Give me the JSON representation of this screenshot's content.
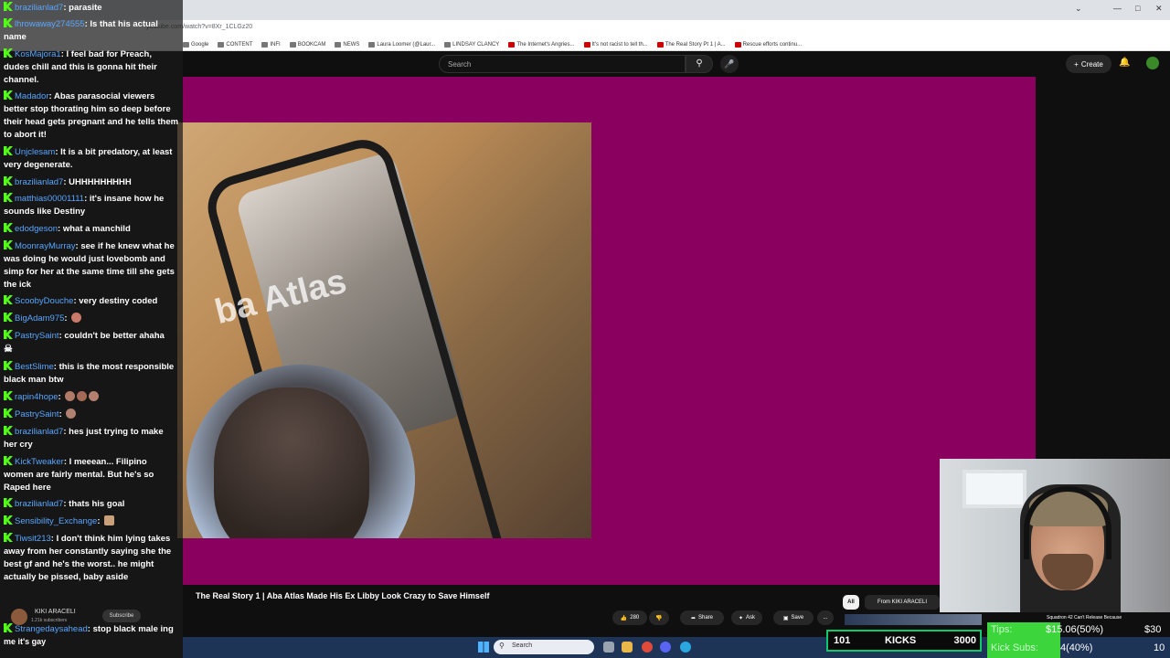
{
  "browser": {
    "url": "youtube.com/watch?v=8Xr_1CLGz20",
    "bookmarks": [
      "Google",
      "CONTENT",
      "INFI",
      "BOOKCAM",
      "NEWS",
      "Laura Loomer (@Laur...",
      "LINDSAY CLANCY",
      "The Internet's Angries...",
      "It's not racist to tell th...",
      "The Real Story Pt 1 | A...",
      "Rescue efforts continu..."
    ]
  },
  "youtube": {
    "search_placeholder": "Search",
    "create_label": "Create",
    "video_overlay_text": "ba Atlas",
    "video_title": "The Real Story 1 | Aba Atlas Made His Ex Libby Look Crazy to Save Himself",
    "channel_name": "KIKI ARACELI",
    "channel_subs": "1.21k subscribers",
    "subscribe_label": "Subscribe",
    "like_count": "280",
    "share_label": "Share",
    "ask_label": "Ask",
    "save_label": "Save",
    "more_label": "...",
    "chip_all": "All",
    "chip_from": "From KIKI ARACELI",
    "rec_title": "Squadron 42 Can't Release Because"
  },
  "chat": {
    "messages": [
      {
        "user": "brazilianlad7",
        "text": "parasite"
      },
      {
        "user": "lhrowaway274555",
        "text": "Is that his actual name"
      },
      {
        "user": "KosMajora1",
        "text": "I feel bad for Preach, dudes chill and this is gonna hit their channel."
      },
      {
        "user": "Madador",
        "text": "Abas parasocial viewers better stop thorating him so deep before their head gets pregnant and he tells them to abort it!"
      },
      {
        "user": "Unjclesam",
        "text": "It is a bit predatory, at least very degenerate."
      },
      {
        "user": "brazilianlad7",
        "text": "UHHHHHHHHH"
      },
      {
        "user": "matthias00001111",
        "text": "it's insane how he sounds like Destiny"
      },
      {
        "user": "edodgeson",
        "text": "what a manchild"
      },
      {
        "user": "MoonrayMurray",
        "text": "see if he knew what he was doing he would just lovebomb and simp for her at the same time till she gets the ick"
      },
      {
        "user": "ScoobyDouche",
        "text": "very destiny coded"
      },
      {
        "user": "BigAdam975",
        "text": ""
      },
      {
        "user": "PastrySaint",
        "text": "couldn't be better ahaha"
      },
      {
        "user": "BestSlime",
        "text": "this is the most responsible black man btw"
      },
      {
        "user": "rapin4hope",
        "text": ""
      },
      {
        "user": "PastrySaint",
        "text": ""
      },
      {
        "user": "brazilianlad7",
        "text": "hes just trying to make her cry"
      },
      {
        "user": "KickTweaker",
        "text": "I meeean... Filipino women are fairly mental. But he's so Raped here"
      },
      {
        "user": "brazilianlad7",
        "text": "thats his goal"
      },
      {
        "user": "Sensibility_Exchange",
        "text": ""
      },
      {
        "user": "Tiwsit213",
        "text": "I don't think him lying takes away from her constantly saying she the best gf and he's the worst.. he might actually be pissed, baby aside"
      },
      {
        "user": "Strangedaysahead",
        "text": "stop black male ing"
      }
    ],
    "bottom_text": "me it's gay"
  },
  "stream_overlay": {
    "kicks_left": "101",
    "kicks_label": "KICKS",
    "kicks_goal": "3000",
    "tips_label": "Tips:",
    "tips_value": "$15.06(50%)",
    "tips_goal": "$30",
    "subs_label": "Kick Subs:",
    "subs_value": "4(40%)",
    "subs_goal": "10"
  },
  "taskbar": {
    "search_label": "Search"
  },
  "colors": {
    "player_bg": "#8a005e",
    "kick_green": "#53fc18",
    "username_blue": "#58a6ff"
  }
}
